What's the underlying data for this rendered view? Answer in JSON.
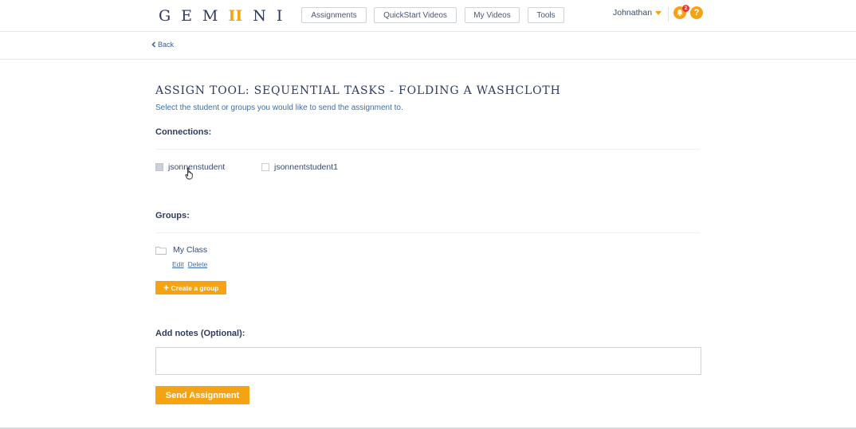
{
  "header": {
    "logo_text": "GEM",
    "logo_mark": "II",
    "logo_tail": "NI",
    "nav": [
      {
        "label": "Assignments"
      },
      {
        "label": "QuickStart Videos"
      },
      {
        "label": "My Videos"
      },
      {
        "label": "Tools"
      }
    ],
    "user_name": "Johnathan",
    "notification_count": "2",
    "help_label": "?",
    "accent_color": "#f5a312"
  },
  "back": {
    "label": "Back"
  },
  "page": {
    "title": "ASSIGN TOOL: SEQUENTIAL TASKS - FOLDING A WASHCLOTH",
    "subtitle": "Select the student or groups you would like to send the assignment to."
  },
  "connections": {
    "label": "Connections:",
    "items": [
      {
        "name": "jsonnenstudent",
        "checked": false
      },
      {
        "name": "jsonnentstudent1",
        "checked": false
      }
    ]
  },
  "groups": {
    "label": "Groups:",
    "items": [
      {
        "name": "My Class",
        "edit_label": "Edit",
        "delete_label": "Delete"
      }
    ],
    "create_label": "Create a group"
  },
  "notes": {
    "label": "Add notes (Optional):",
    "value": "",
    "placeholder": ""
  },
  "submit": {
    "label": "Send Assignment"
  }
}
